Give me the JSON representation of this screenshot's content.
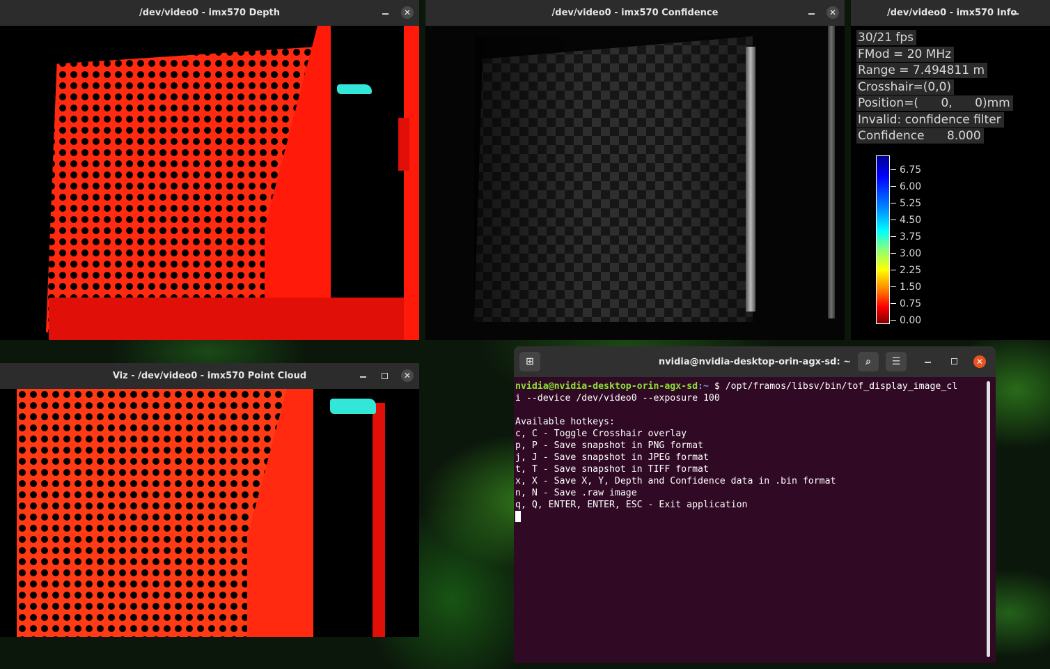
{
  "windows": {
    "depth": {
      "title": "/dev/video0 - imx570 Depth"
    },
    "confidence": {
      "title": "/dev/video0 - imx570 Confidence"
    },
    "info": {
      "title": "/dev/video0 - imx570 Info",
      "lines": [
        "30/21 fps",
        "FMod = 20 MHz",
        "Range = 7.494811 m",
        "Crosshair=(0,0)",
        "Position=(      0,      0)mm",
        "Invalid: confidence filter",
        "Confidence      8.000"
      ],
      "colorbar": {
        "labels": [
          "6.75",
          "6.00",
          "5.25",
          "4.50",
          "3.75",
          "3.00",
          "2.25",
          "1.50",
          "0.75",
          "0.00"
        ]
      }
    },
    "pointcloud": {
      "title": "Viz - /dev/video0 - imx570 Point Cloud"
    },
    "terminal": {
      "title": "nvidia@nvidia-desktop-orin-agx-sd: ~",
      "prompt_user": "nvidia@nvidia-desktop-orin-agx-sd",
      "prompt_path": ":~",
      "command_part1": " $ /opt/framos/libsv/bin/tof_display_image_cl",
      "command_part2": "i --device /dev/video0 --exposure 100",
      "output": [
        "",
        "Available hotkeys:",
        "c, C - Toggle Crosshair overlay",
        "p, P - Save snapshot in PNG format",
        "j, J - Save snapshot in JPEG format",
        "t, T - Save snapshot in TIFF format",
        "x, X - Save X, Y, Depth and Confidence data in .bin format",
        "n, N - Save .raw image",
        "q, Q, ENTER, ENTER, ESC - Exit application"
      ]
    }
  },
  "icons": {
    "close": "✕",
    "new_tab": "⊞",
    "search": "⌕",
    "menu": "☰"
  },
  "colors": {
    "depth_red": "#ff2a10",
    "terminal_bg": "#300a24",
    "prompt_green": "#8ae234",
    "prompt_blue": "#729fcf",
    "close_red": "#e95420"
  }
}
